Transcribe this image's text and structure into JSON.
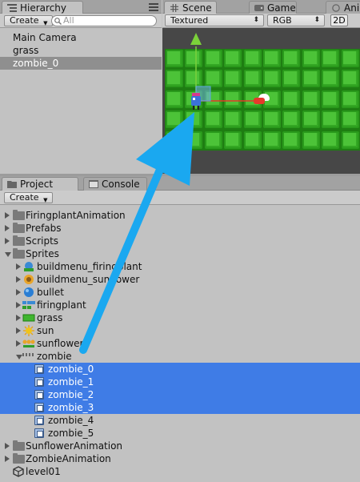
{
  "hierarchy": {
    "tab_label": "Hierarchy",
    "create_label": "Create",
    "search_placeholder": "All",
    "items": [
      {
        "label": "Main Camera"
      },
      {
        "label": "grass"
      },
      {
        "label": "zombie_0"
      }
    ]
  },
  "scene": {
    "tabs": [
      {
        "label": "Scene"
      },
      {
        "label": "Game"
      },
      {
        "label": "Anim"
      }
    ],
    "shading_mode": "Textured",
    "render_mode": "RGB",
    "mode_2d": "2D"
  },
  "project": {
    "tabs": [
      {
        "label": "Project"
      },
      {
        "label": "Console"
      }
    ],
    "create_label": "Create",
    "folders_top": [
      {
        "label": "FiringplantAnimation"
      },
      {
        "label": "Prefabs"
      },
      {
        "label": "Scripts"
      },
      {
        "label": "Sprites"
      }
    ],
    "sprites": [
      {
        "label": "buildmenu_firingplant"
      },
      {
        "label": "buildmenu_sunflower"
      },
      {
        "label": "bullet"
      },
      {
        "label": "firingplant"
      },
      {
        "label": "grass"
      },
      {
        "label": "sun"
      },
      {
        "label": "sunflower"
      },
      {
        "label": "zombie"
      }
    ],
    "zombie_frames": [
      {
        "label": "zombie_0"
      },
      {
        "label": "zombie_1"
      },
      {
        "label": "zombie_2"
      },
      {
        "label": "zombie_3"
      },
      {
        "label": "zombie_4"
      },
      {
        "label": "zombie_5"
      }
    ],
    "folders_bottom": [
      {
        "label": "SunflowerAnimation"
      },
      {
        "label": "ZombieAnimation"
      }
    ],
    "scene_file": "level01"
  },
  "colors": {
    "selection": "#3f7ce6",
    "arrow": "#1aa8f0",
    "grass": "#4cc338"
  }
}
